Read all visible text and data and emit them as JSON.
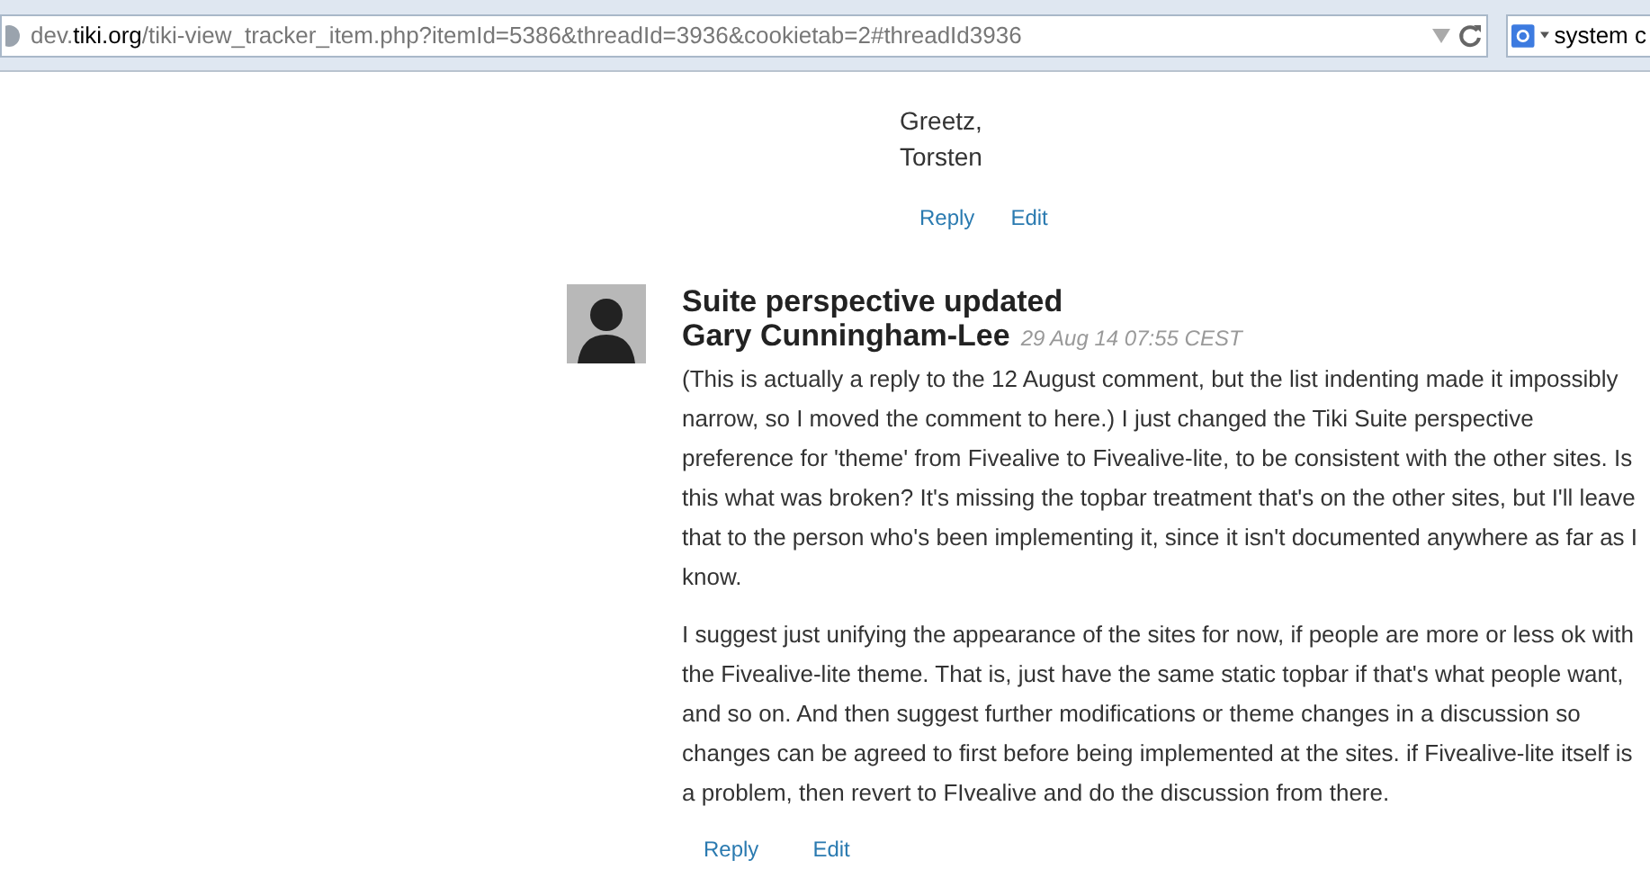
{
  "browser": {
    "url_host": "dev.",
    "url_domain": "tiki.org",
    "url_path": "/tiki-view_tracker_item.php?itemId=5386&threadId=3936&cookietab=2#threadId3936",
    "search_text": "system c"
  },
  "previous_comment": {
    "lines": [
      "Greetz,",
      "Torsten"
    ],
    "actions": [
      "Reply",
      "Edit"
    ]
  },
  "comment": {
    "title": "Suite perspective updated",
    "author": "Gary Cunningham-Lee",
    "date": "29 Aug 14 07:55 CEST",
    "paragraphs": [
      "(This is actually a reply to the 12 August comment, but the list indenting made it impossibly narrow, so I moved the comment to here.) I just changed the Tiki Suite perspective preference for 'theme' from Fivealive to Fivealive-lite, to be consistent with the other sites. Is this what was broken? It's missing the topbar treatment that's on the other sites, but I'll leave that to the person who's been implementing it, since it isn't documented anywhere as far as I know.",
      "I suggest just unifying the appearance of the sites for now, if people are more or less ok with the Fivealive-lite theme. That is, just have the same static topbar if that's what people want, and so on. And then suggest further modifications or theme changes in a discussion so changes can be agreed to first before being implemented at the sites. if Fivealive-lite itself is a problem, then revert to FIvealive and do the discussion from there."
    ],
    "actions": [
      "Reply",
      "Edit"
    ]
  }
}
